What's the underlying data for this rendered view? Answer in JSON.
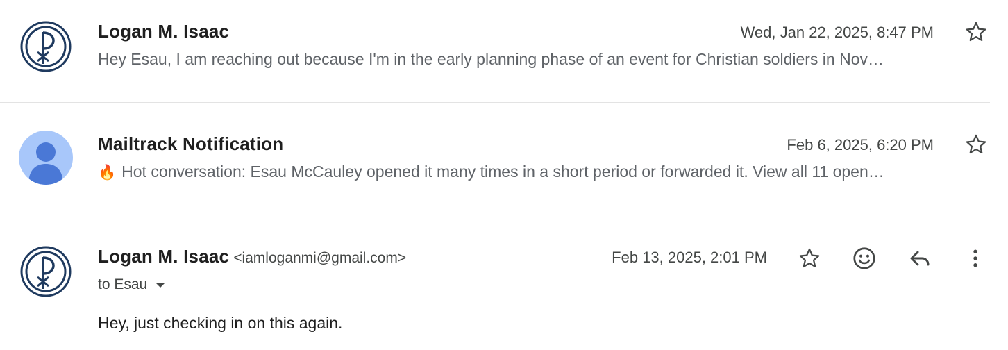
{
  "messages": [
    {
      "sender": "Logan M. Isaac",
      "date": "Wed, Jan 22, 2025, 8:47 PM",
      "snippet": "Hey Esau, I am reaching out because I'm in the early planning phase of an event for Christian soldiers in Nov…",
      "avatar": "chi-rho-logo"
    },
    {
      "sender": "Mailtrack Notification",
      "date": "Feb 6, 2025, 6:20 PM",
      "snippet_emoji": "🔥",
      "snippet": "Hot conversation: Esau McCauley opened it many times in a short period or forwarded it. View all 11 open…",
      "avatar": "default-person-avatar"
    },
    {
      "sender": "Logan M. Isaac",
      "email": "<iamloganmi@gmail.com>",
      "date": "Feb 13, 2025, 2:01 PM",
      "to": "to Esau",
      "body": "Hey, just checking in on this again.",
      "avatar": "chi-rho-logo",
      "actions": [
        "star-icon",
        "emoji-react-icon",
        "reply-icon",
        "more-vert-icon"
      ]
    }
  ],
  "colors": {
    "logo": "#1f3a5f",
    "avatar_bg": "#a8c7fa",
    "avatar_fg": "#4a78d6",
    "divider": "#e3e3e3"
  }
}
